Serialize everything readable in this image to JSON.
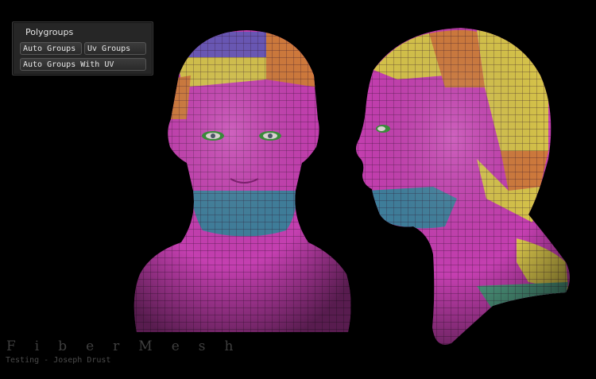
{
  "polygroups_panel": {
    "title": "Polygroups",
    "buttons": {
      "auto_groups": "Auto Groups",
      "uv_groups": "Uv Groups",
      "auto_groups_with_uv": "Auto Groups With UV"
    }
  },
  "watermark": {
    "brand": "FiberMesh",
    "credit": "Testing - Joseph Drust"
  },
  "colors": {
    "background": "#000000",
    "polygroup_magenta": "#c43fb0",
    "polygroup_yellow": "#d6c34a",
    "polygroup_orange": "#d07a3c",
    "polygroup_purple": "#6a57b8",
    "polygroup_teal": "#3f7f9c",
    "polygroup_green": "#4f9a80",
    "wireframe": "#3a1a38"
  }
}
